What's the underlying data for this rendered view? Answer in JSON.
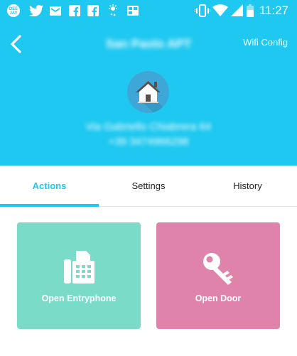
{
  "status_bar": {
    "time": "11:27",
    "icons": [
      "deejay-icon",
      "twitter-icon",
      "inbox-icon",
      "facebook-icon",
      "facebook-icon",
      "weather-icon",
      "flipboard-icon",
      "vibrate-icon",
      "wifi-icon",
      "signal-icon",
      "battery-icon"
    ]
  },
  "header": {
    "title": "San Paolo APT",
    "wifi_config_label": "Wifi Config",
    "address_line1": "Via Gabriello Chiabrera 64",
    "address_line2": "+39 3474966298",
    "avatar_icon": "home-icon",
    "colors": {
      "background": "#1ec8f0",
      "avatar_bg": "#3fa7d8"
    }
  },
  "tabs": [
    {
      "label": "Actions",
      "active": true
    },
    {
      "label": "Settings",
      "active": false
    },
    {
      "label": "History",
      "active": false
    }
  ],
  "actions": [
    {
      "label": "Open Entryphone",
      "icon": "fax-phone-icon",
      "color": "#79dbc8"
    },
    {
      "label": "Open Door",
      "icon": "key-icon",
      "color": "#e083aa"
    }
  ]
}
